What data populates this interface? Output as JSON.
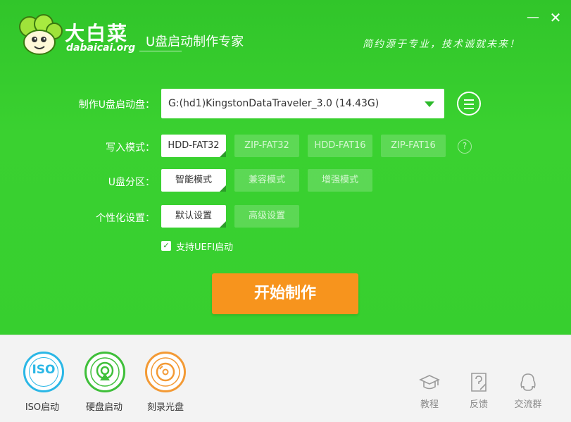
{
  "header": {
    "brand_name": "大白菜",
    "brand_domain": "dabaicai.org",
    "app_title": "U盘启动制作专家",
    "slogan": "简约源于专业，技术诚就未来！",
    "minimize_glyph": "—",
    "close_glyph": "✕"
  },
  "form": {
    "device_label": "制作U盘启动盘：",
    "device_value": "G:(hd1)KingstonDataTraveler_3.0 (14.43G)",
    "write_mode_label": "写入模式：",
    "write_modes": [
      "HDD-FAT32",
      "ZIP-FAT32",
      "HDD-FAT16",
      "ZIP-FAT16"
    ],
    "write_mode_selected": "HDD-FAT32",
    "partition_label": "U盘分区：",
    "partition_modes": [
      "智能模式",
      "兼容模式",
      "增强模式"
    ],
    "partition_selected": "智能模式",
    "personalize_label": "个性化设置：",
    "personalize_options": [
      "默认设置",
      "高级设置"
    ],
    "personalize_selected": "默认设置",
    "uefi_label": "支持UEFI启动",
    "uefi_checked": true,
    "help_glyph": "?",
    "start_button": "开始制作"
  },
  "tools": [
    {
      "label": "ISO启动",
      "icon": "iso-icon",
      "icon_text": "ISO",
      "color": "#2bb7e6"
    },
    {
      "label": "硬盘启动",
      "icon": "disk-icon",
      "color": "#3fbf3a"
    },
    {
      "label": "刻录光盘",
      "icon": "cd-icon",
      "color": "#f39a35"
    }
  ],
  "side_links": [
    {
      "label": "教程",
      "icon": "graduation-cap-icon"
    },
    {
      "label": "反馈",
      "icon": "feedback-icon"
    },
    {
      "label": "交流群",
      "icon": "qq-penguin-icon"
    }
  ],
  "colors": {
    "brand_green": "#37cf2f",
    "start_orange": "#f7941d",
    "iso_blue": "#2bb7e6",
    "cd_orange": "#f39a35"
  }
}
